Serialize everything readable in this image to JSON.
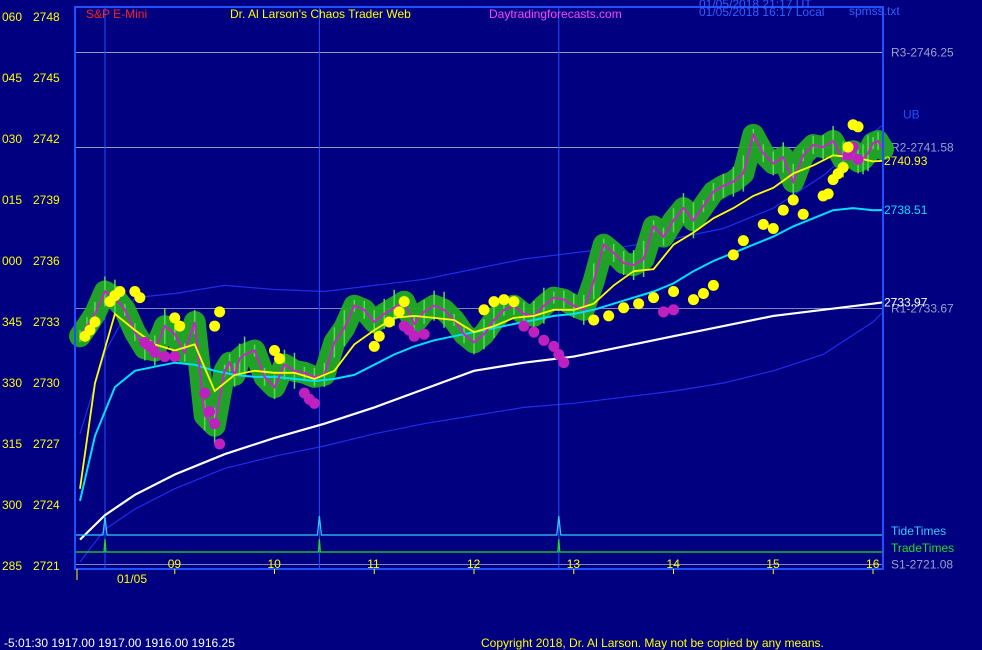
{
  "header": {
    "instrument": "S&P E-Mini",
    "site": "Dr. Al Larson's Chaos Trader Web",
    "url": "Daytradingforecasts.com",
    "stamp_utc": "01/05/2018 21:17 UT",
    "stamp_local": "01/05/2018 16:17 Local",
    "file": "spmss.txt"
  },
  "colors": {
    "background": "#000080",
    "frame": "#2050ff",
    "gridline": "#b0b0d0",
    "yellow": "#ffff00",
    "cyan": "#00e0ff",
    "white": "#ffffff",
    "magenta": "#cc22cc",
    "green": "#22aa22",
    "band": "#1e2ee8",
    "red": "#ff2020"
  },
  "footer": {
    "quote": "-5:01:30  1917.00 1917.00 1916.00 1916.25",
    "copyright": "Copyright 2018, Dr. Al Larson. May not be copied by any means."
  },
  "chart_data": {
    "type": "line",
    "x_ticks": [
      "09",
      "10",
      "11",
      "12",
      "13",
      "14",
      "15",
      "16"
    ],
    "x_ticks_hours": [
      9,
      10,
      11,
      12,
      13,
      14,
      15,
      16
    ],
    "x_date_label": "01/05",
    "x_range": [
      8.0,
      16.1
    ],
    "ylim": [
      2721,
      2748
    ],
    "y_ticks": [
      {
        "left": "285",
        "price": "2721",
        "value": 2721
      },
      {
        "left": "300",
        "price": "2724",
        "value": 2724
      },
      {
        "left": "315",
        "price": "2727",
        "value": 2727
      },
      {
        "left": "330",
        "price": "2730",
        "value": 2730
      },
      {
        "left": "345",
        "price": "2733",
        "value": 2733
      },
      {
        "left": "000",
        "price": "2736",
        "value": 2736
      },
      {
        "left": "015",
        "price": "2739",
        "value": 2739
      },
      {
        "left": "030",
        "price": "2742",
        "value": 2742
      },
      {
        "left": "045",
        "price": "2745",
        "value": 2745
      },
      {
        "left": "060",
        "price": "2748",
        "value": 2748
      }
    ],
    "levels": [
      {
        "label": "R3-2746.25",
        "value": 2746.25
      },
      {
        "label": "R2-2741.58",
        "value": 2741.58
      },
      {
        "label": "R1-2733.67",
        "value": 2733.67
      },
      {
        "label": "S1-2721.08",
        "value": 2721.08
      }
    ],
    "right_labels": [
      {
        "text": "UB",
        "value": 2743.2,
        "color": "#2050ff"
      },
      {
        "text": "2740.93",
        "value": 2740.93,
        "color": "#ffff00"
      },
      {
        "text": "2738.51",
        "value": 2738.51,
        "color": "#00e0ff"
      },
      {
        "text": "2733.97",
        "value": 2733.97,
        "color": "#ffffff"
      }
    ],
    "tide_label": "TideTimes",
    "trade_label": "TradeTimes",
    "time_markers": [
      10.45,
      12.85
    ],
    "series": [
      {
        "role": "price",
        "color": "#22cc22",
        "x": [
          8.05,
          8.12,
          8.2,
          8.3,
          8.4,
          8.5,
          8.6,
          8.7,
          8.8,
          8.9,
          9.0,
          9.1,
          9.2,
          9.3,
          9.4,
          9.5,
          9.55,
          9.6,
          9.65,
          9.7,
          9.8,
          9.9,
          10.0,
          10.1,
          10.2,
          10.3,
          10.4,
          10.5,
          10.6,
          10.7,
          10.8,
          10.9,
          11.0,
          11.1,
          11.2,
          11.3,
          11.4,
          11.5,
          11.6,
          11.7,
          11.8,
          11.9,
          12.0,
          12.1,
          12.2,
          12.3,
          12.4,
          12.5,
          12.6,
          12.7,
          12.8,
          12.9,
          13.0,
          13.1,
          13.2,
          13.3,
          13.4,
          13.5,
          13.6,
          13.7,
          13.8,
          13.9,
          14.0,
          14.1,
          14.2,
          14.3,
          14.4,
          14.5,
          14.6,
          14.7,
          14.8,
          14.9,
          15.0,
          15.1,
          15.2,
          15.3,
          15.4,
          15.5,
          15.6,
          15.7,
          15.75,
          15.8,
          15.85,
          15.9,
          15.95,
          16.0,
          16.05,
          16.1
        ],
        "y": [
          2732.3,
          2732.8,
          2733.4,
          2734.5,
          2734.2,
          2733.6,
          2732.5,
          2731.7,
          2731.6,
          2732.8,
          2732.4,
          2731.5,
          2733.0,
          2728.4,
          2727.9,
          2730.6,
          2731.0,
          2730.4,
          2731.2,
          2731.4,
          2731.6,
          2730.3,
          2729.8,
          2730.9,
          2730.6,
          2730.5,
          2730.3,
          2730.4,
          2732.0,
          2732.7,
          2733.8,
          2733.6,
          2733.0,
          2733.4,
          2733.7,
          2734.0,
          2732.9,
          2733.5,
          2733.8,
          2733.6,
          2733.1,
          2732.4,
          2732.0,
          2732.4,
          2733.1,
          2733.6,
          2733.8,
          2733.4,
          2733.3,
          2733.8,
          2734.2,
          2734.1,
          2733.8,
          2733.6,
          2735.0,
          2736.8,
          2736.4,
          2735.9,
          2735.8,
          2736.1,
          2737.7,
          2737.2,
          2738.0,
          2738.6,
          2738.0,
          2738.7,
          2739.4,
          2739.7,
          2739.9,
          2740.3,
          2742.2,
          2741.3,
          2740.8,
          2741.1,
          2739.9,
          2741.2,
          2741.7,
          2741.6,
          2741.9,
          2741.0,
          2741.3,
          2741.4,
          2740.9,
          2741.0,
          2741.3,
          2741.8,
          2741.9,
          2741.5
        ]
      },
      {
        "role": "fast-average",
        "color": "#ffff00",
        "x": [
          8.05,
          8.2,
          8.4,
          8.6,
          8.8,
          9.0,
          9.2,
          9.4,
          9.6,
          9.8,
          10.0,
          10.2,
          10.4,
          10.6,
          10.8,
          11.0,
          11.2,
          11.4,
          11.6,
          11.8,
          12.0,
          12.2,
          12.4,
          12.6,
          12.8,
          13.0,
          13.2,
          13.4,
          13.6,
          13.8,
          14.0,
          14.2,
          14.4,
          14.6,
          14.8,
          15.0,
          15.2,
          15.4,
          15.6,
          15.8,
          15.9,
          16.0,
          16.1
        ],
        "y": [
          2724.8,
          2730.0,
          2733.4,
          2732.6,
          2731.9,
          2731.6,
          2731.9,
          2729.6,
          2730.4,
          2730.6,
          2730.5,
          2730.5,
          2730.2,
          2730.6,
          2731.9,
          2732.6,
          2733.2,
          2733.3,
          2733.2,
          2733.1,
          2732.5,
          2732.8,
          2733.2,
          2733.3,
          2733.6,
          2733.6,
          2733.9,
          2734.8,
          2735.5,
          2735.6,
          2736.8,
          2737.4,
          2738.1,
          2738.6,
          2739.2,
          2739.6,
          2740.3,
          2740.7,
          2741.2,
          2741.1,
          2741.0,
          2740.9,
          2740.93
        ]
      },
      {
        "role": "slow-average",
        "color": "#00e0ff",
        "x": [
          8.05,
          8.2,
          8.4,
          8.6,
          8.8,
          9.0,
          9.2,
          9.4,
          9.6,
          9.8,
          10.0,
          10.2,
          10.4,
          10.6,
          10.8,
          11.0,
          11.2,
          11.4,
          11.6,
          11.8,
          12.0,
          12.2,
          12.4,
          12.6,
          12.8,
          13.0,
          13.2,
          13.4,
          13.6,
          13.8,
          14.0,
          14.2,
          14.4,
          14.6,
          14.8,
          15.0,
          15.2,
          15.4,
          15.6,
          15.8,
          16.0,
          16.1
        ],
        "y": [
          2724.2,
          2727.4,
          2729.8,
          2730.6,
          2730.8,
          2731.0,
          2730.9,
          2730.6,
          2730.4,
          2730.3,
          2730.3,
          2730.2,
          2730.1,
          2730.2,
          2730.4,
          2730.9,
          2731.4,
          2731.8,
          2732.1,
          2732.3,
          2732.5,
          2732.7,
          2732.9,
          2733.1,
          2733.3,
          2733.4,
          2733.6,
          2733.9,
          2734.2,
          2734.5,
          2734.9,
          2735.5,
          2736.0,
          2736.4,
          2736.8,
          2737.2,
          2737.7,
          2738.1,
          2738.5,
          2738.6,
          2738.5,
          2738.51
        ]
      },
      {
        "role": "long-average",
        "color": "#ffffff",
        "x": [
          8.05,
          8.3,
          8.6,
          9.0,
          9.5,
          10.0,
          10.5,
          11.0,
          11.5,
          12.0,
          12.5,
          13.0,
          13.5,
          14.0,
          14.5,
          15.0,
          15.5,
          16.0,
          16.1
        ],
        "y": [
          2722.3,
          2723.5,
          2724.5,
          2725.5,
          2726.5,
          2727.3,
          2728.0,
          2728.8,
          2729.7,
          2730.6,
          2731.0,
          2731.3,
          2731.8,
          2732.3,
          2732.8,
          2733.3,
          2733.6,
          2733.9,
          2733.97
        ]
      },
      {
        "role": "upper-band",
        "color": "#1e2ee8",
        "x": [
          8.05,
          8.3,
          8.6,
          9.0,
          9.5,
          10.0,
          10.5,
          11.0,
          11.5,
          12.0,
          12.5,
          13.0,
          13.5,
          14.0,
          14.5,
          15.0,
          15.5,
          16.0,
          16.1
        ],
        "y": [
          2727.5,
          2731.5,
          2734.2,
          2734.4,
          2734.8,
          2734.6,
          2734.5,
          2734.8,
          2735.1,
          2735.6,
          2736.1,
          2736.4,
          2736.7,
          2737.1,
          2737.6,
          2738.6,
          2740.2,
          2742.3,
          2742.7
        ]
      },
      {
        "role": "lower-band",
        "color": "#1e2ee8",
        "x": [
          8.05,
          8.3,
          8.6,
          9.0,
          9.5,
          10.0,
          10.5,
          11.0,
          11.5,
          12.0,
          12.5,
          13.0,
          13.5,
          14.0,
          14.5,
          15.0,
          15.5,
          16.0,
          16.1
        ],
        "y": [
          2721.2,
          2722.8,
          2723.8,
          2724.8,
          2725.8,
          2726.4,
          2726.9,
          2727.5,
          2728.0,
          2728.4,
          2728.8,
          2729.0,
          2729.3,
          2729.6,
          2730.0,
          2730.6,
          2731.4,
          2733.0,
          2733.5
        ]
      }
    ],
    "markers": {
      "yellow_x": [
        8.1,
        8.15,
        8.2,
        8.35,
        8.4,
        8.45,
        8.6,
        8.65,
        9.0,
        9.05,
        9.4,
        9.45,
        10.0,
        10.05,
        11.0,
        11.05,
        11.15,
        11.25,
        11.3,
        12.1,
        12.2,
        12.3,
        12.4,
        13.2,
        13.35,
        13.5,
        13.65,
        13.8,
        14.0,
        14.2,
        14.3,
        14.4,
        14.6,
        14.7,
        14.9,
        15.0,
        15.1,
        15.2,
        15.3,
        15.5,
        15.55,
        15.6,
        15.65,
        15.7,
        15.75,
        15.8,
        15.85
      ],
      "yellow_y": [
        2732.3,
        2732.6,
        2733.0,
        2734.0,
        2734.3,
        2734.5,
        2734.5,
        2734.2,
        2733.2,
        2732.8,
        2732.8,
        2733.5,
        2731.6,
        2731.2,
        2731.8,
        2732.3,
        2733.0,
        2733.5,
        2734.0,
        2733.6,
        2734.0,
        2734.1,
        2734.0,
        2733.1,
        2733.3,
        2733.7,
        2733.9,
        2734.2,
        2734.5,
        2734.1,
        2734.4,
        2734.8,
        2736.3,
        2737.0,
        2737.8,
        2737.6,
        2738.5,
        2739.0,
        2738.3,
        2739.2,
        2739.3,
        2740.0,
        2740.3,
        2740.6,
        2741.6,
        2742.7,
        2742.6
      ],
      "magenta_x": [
        8.7,
        8.75,
        8.8,
        8.9,
        9.0,
        9.3,
        9.35,
        9.4,
        9.45,
        10.3,
        10.35,
        10.4,
        11.3,
        11.35,
        11.4,
        11.5,
        12.5,
        12.6,
        12.7,
        12.8,
        12.85,
        12.9,
        13.9,
        14.0,
        15.75,
        15.8,
        15.85
      ],
      "magenta_y": [
        2732.0,
        2731.8,
        2731.5,
        2731.3,
        2731.3,
        2729.5,
        2728.6,
        2728.0,
        2727.0,
        2729.5,
        2729.2,
        2729.0,
        2732.8,
        2732.6,
        2732.3,
        2732.4,
        2732.8,
        2732.5,
        2732.1,
        2731.8,
        2731.4,
        2731.0,
        2733.5,
        2733.6,
        2741.2,
        2741.6,
        2741.0
      ]
    }
  }
}
